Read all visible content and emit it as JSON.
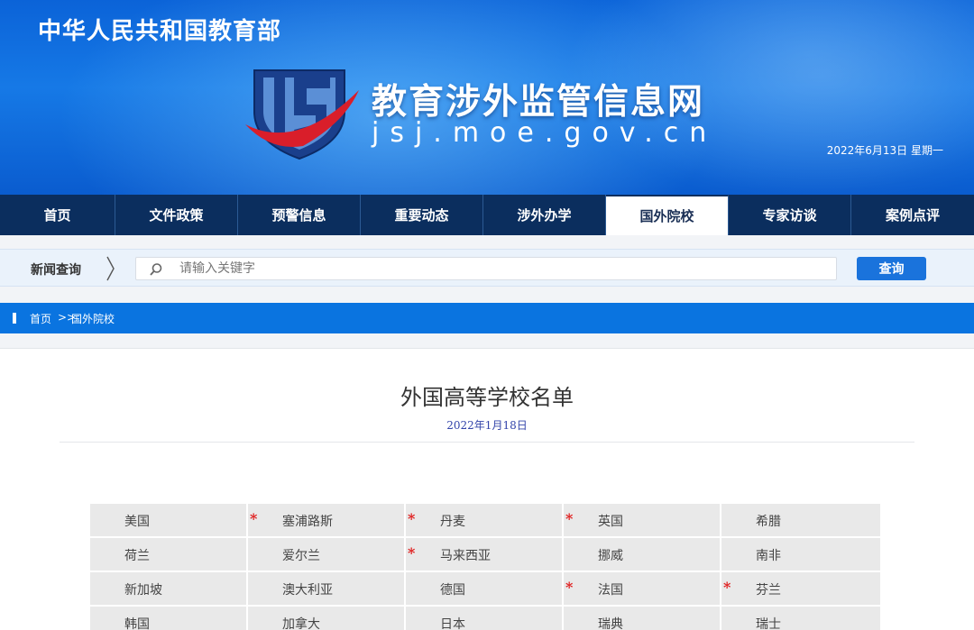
{
  "header": {
    "ministry": "中华人民共和国教育部",
    "site_title": "教育涉外监管信息网",
    "site_domain": "jsj.moe.gov.cn",
    "date": "2022年6月13日  星期一"
  },
  "nav": {
    "items": [
      {
        "label": "首页"
      },
      {
        "label": "文件政策"
      },
      {
        "label": "预警信息"
      },
      {
        "label": "重要动态"
      },
      {
        "label": "涉外办学"
      },
      {
        "label": "国外院校"
      },
      {
        "label": "专家访谈"
      },
      {
        "label": "案例点评"
      }
    ],
    "active": "国外院校"
  },
  "search": {
    "label": "新闻查询",
    "placeholder": "请输入关键字",
    "value": "",
    "button_label": "查询"
  },
  "breadcrumb": {
    "home": "首页",
    "separator": ">>",
    "current": "国外院校"
  },
  "article": {
    "title": "外国高等学校名单",
    "date": "2022年1月18日"
  },
  "countries": [
    {
      "name": "美国",
      "star": false
    },
    {
      "name": "塞浦路斯",
      "star": true
    },
    {
      "name": "丹麦",
      "star": true
    },
    {
      "name": "英国",
      "star": true
    },
    {
      "name": "希腊",
      "star": false
    },
    {
      "name": "荷兰",
      "star": false
    },
    {
      "name": "爱尔兰",
      "star": false
    },
    {
      "name": "马来西亚",
      "star": true
    },
    {
      "name": "挪威",
      "star": false
    },
    {
      "name": "南非",
      "star": false
    },
    {
      "name": "新加坡",
      "star": false
    },
    {
      "name": "澳大利亚",
      "star": false
    },
    {
      "name": "德国",
      "star": false
    },
    {
      "name": "法国",
      "star": true
    },
    {
      "name": "芬兰",
      "star": true
    },
    {
      "name": "韩国",
      "star": false
    },
    {
      "name": "加拿大",
      "star": false
    },
    {
      "name": "日本",
      "star": false
    },
    {
      "name": "瑞典",
      "star": false
    },
    {
      "name": "瑞士",
      "star": false
    }
  ],
  "star_symbol": "*",
  "colors": {
    "header_blue": "#1679e6",
    "nav_navy": "#0b2e5e",
    "breadcrumb_blue": "#0a74e0",
    "button_blue": "#1a73dc",
    "star_red": "#e02020"
  }
}
